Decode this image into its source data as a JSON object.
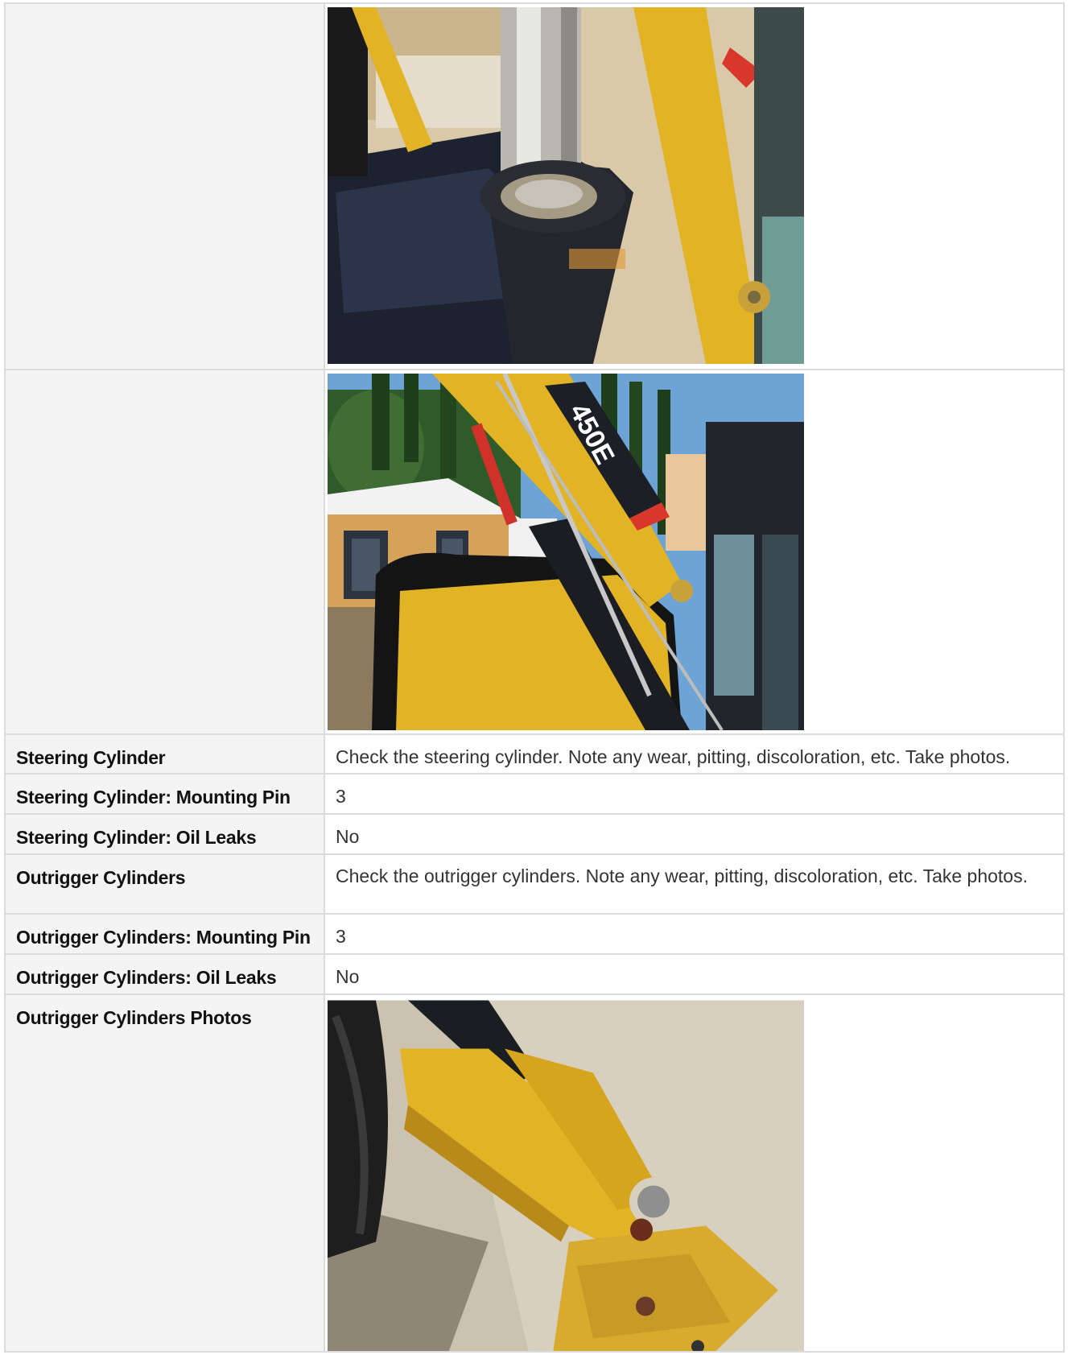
{
  "rows": [
    {
      "label": "",
      "photo": "cylinder-closeup-photo"
    },
    {
      "label": "",
      "photo": "loader-arm-450e-photo",
      "model_badge": "450E"
    },
    {
      "label": "Steering Cylinder",
      "value": "Check the steering cylinder. Note any wear, pitting, discoloration, etc. Take photos."
    },
    {
      "label": "Steering Cylinder: Mounting Pin",
      "value": "3"
    },
    {
      "label": "Steering Cylinder: Oil Leaks",
      "value": "No"
    },
    {
      "label": "Outrigger Cylinders",
      "value": "Check the outrigger cylinders. Note any wear, pitting, discoloration, etc. Take photos."
    },
    {
      "label": "Outrigger Cylinders: Mounting Pin",
      "value": "3"
    },
    {
      "label": "Outrigger Cylinders: Oil Leaks",
      "value": "No"
    },
    {
      "label": "Outrigger Cylinders Photos",
      "photo": "outrigger-stabilizer-photo"
    }
  ],
  "colors": {
    "border": "#dcdcdc",
    "label_bg": "#f4f4f4",
    "machine_yellow": "#e2b324",
    "machine_black": "#1c1f26"
  }
}
